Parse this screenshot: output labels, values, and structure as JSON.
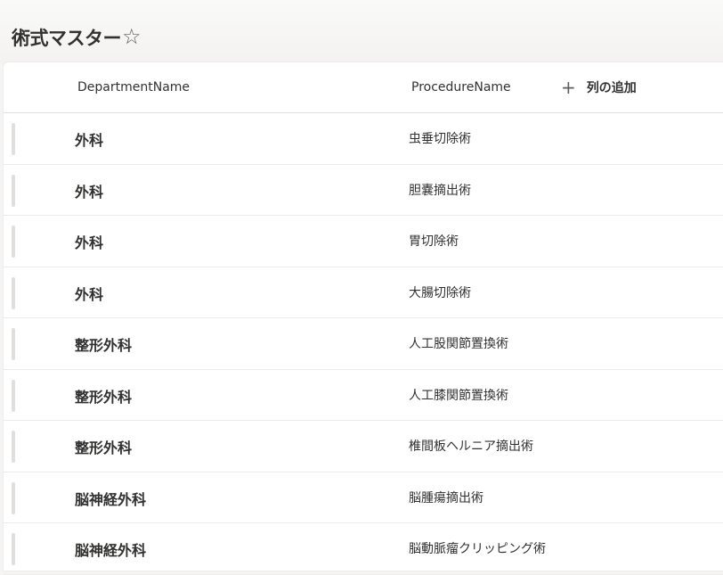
{
  "page": {
    "title": "術式マスター"
  },
  "columns": {
    "department": "DepartmentName",
    "procedure": "ProcedureName",
    "add_column": "列の追加"
  },
  "rows": [
    {
      "department": "外科",
      "procedure": "虫垂切除術"
    },
    {
      "department": "外科",
      "procedure": "胆嚢摘出術"
    },
    {
      "department": "外科",
      "procedure": "胃切除術"
    },
    {
      "department": "外科",
      "procedure": "大腸切除術"
    },
    {
      "department": "整形外科",
      "procedure": "人工股関節置換術"
    },
    {
      "department": "整形外科",
      "procedure": "人工膝関節置換術"
    },
    {
      "department": "整形外科",
      "procedure": "椎間板ヘルニア摘出術"
    },
    {
      "department": "脳神経外科",
      "procedure": "脳腫瘍摘出術"
    },
    {
      "department": "脳神経外科",
      "procedure": "脳動脈瘤クリッピング術"
    }
  ],
  "icons": {
    "favorite": "star-outline-icon",
    "add": "plus-icon"
  }
}
